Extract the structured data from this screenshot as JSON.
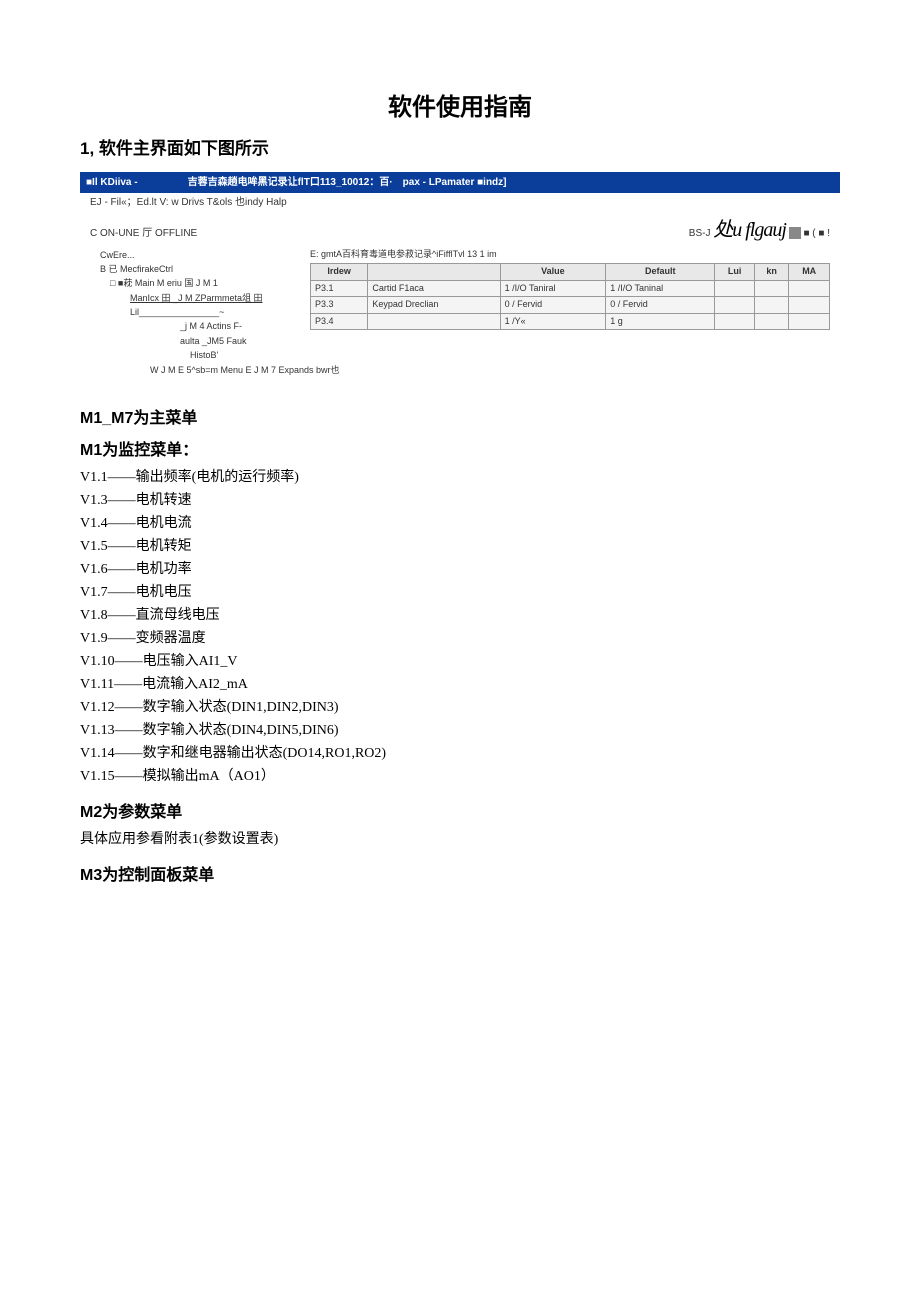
{
  "title": "软件使用指南",
  "section1": "1, 软件主界面如下图所示",
  "screenshot": {
    "titlebar": "■Il KDiiva -　　　　　吉蓉吉森趟电哞黑记录让flT口113_10012：百·　pax - LPamater ■indz]",
    "menubar": "EJ - Fil«；Ed.lt V: w Drivs T&ols 也indy Halp",
    "toolbar_left": "C ON-UNE 厅 OFFLINE",
    "toolbar_right_prefix": "BS-J",
    "toolbar_logo": "处u flgauj",
    "toolbar_right_suffix": "■  ( ■ !",
    "tree": {
      "n0": "CwEre...",
      "n1": "B 已 MecfirakeCtrl",
      "n2": "□  ■萙  Main M eriu 国  J M 1",
      "n3": "ManIcx 田  _J M ZParmmeta俎  田",
      "n4": "Lil________________~",
      "n5": "_j M 4 Actins F-",
      "n6": "aulta  _JM5 Fauk",
      "n7": "HistoB'",
      "foot": "W J M E 5^sb=m Menu E J M 7 Expands bwr也"
    },
    "caption": "E: gmtA百科育毒道电参菽记录^iFifflTvl 13 1 im",
    "table": {
      "headers": [
        "Irdew",
        "",
        "Value",
        "Default",
        "Lui",
        "kn",
        "MA"
      ],
      "rows": [
        [
          "P3.1",
          "Cartid F1aca",
          "1 /I/O Taniral",
          "1 /I/O Taninal",
          "",
          "",
          ""
        ],
        [
          "P3.3",
          "Keypad Dreclian",
          "0 / Fervid",
          "0 / Fervid",
          "",
          "",
          ""
        ],
        [
          "P3.4",
          "",
          "1 /Y«",
          "1 g",
          "",
          "",
          ""
        ]
      ]
    }
  },
  "m_head": "M1_M7为主菜单",
  "m1_head": "M1为监控菜单：",
  "m1_items": [
    "V1.1——输出频率(电机的运行频率)",
    "V1.3——电机转速",
    "V1.4——电机电流",
    "V1.5——电机转矩",
    "V1.6——电机功率",
    "V1.7——电机电压",
    "V1.8——直流母线电压",
    "V1.9——变频器温度",
    "V1.10——电压输入AI1_V",
    "V1.11——电流输入AI2_mA",
    "V1.12——数字输入状态(DIN1,DIN2,DIN3)",
    "V1.13——数字输入状态(DIN4,DIN5,DIN6)",
    "V1.14——数字和继电器输出状态(DO14,RO1,RO2)",
    "V1.15——模拟输出mA（AO1）"
  ],
  "m2_head": "M2为参数菜单",
  "m2_body": "具体应用参看附表1(参数设置表)",
  "m3_head": "M3为控制面板菜单"
}
